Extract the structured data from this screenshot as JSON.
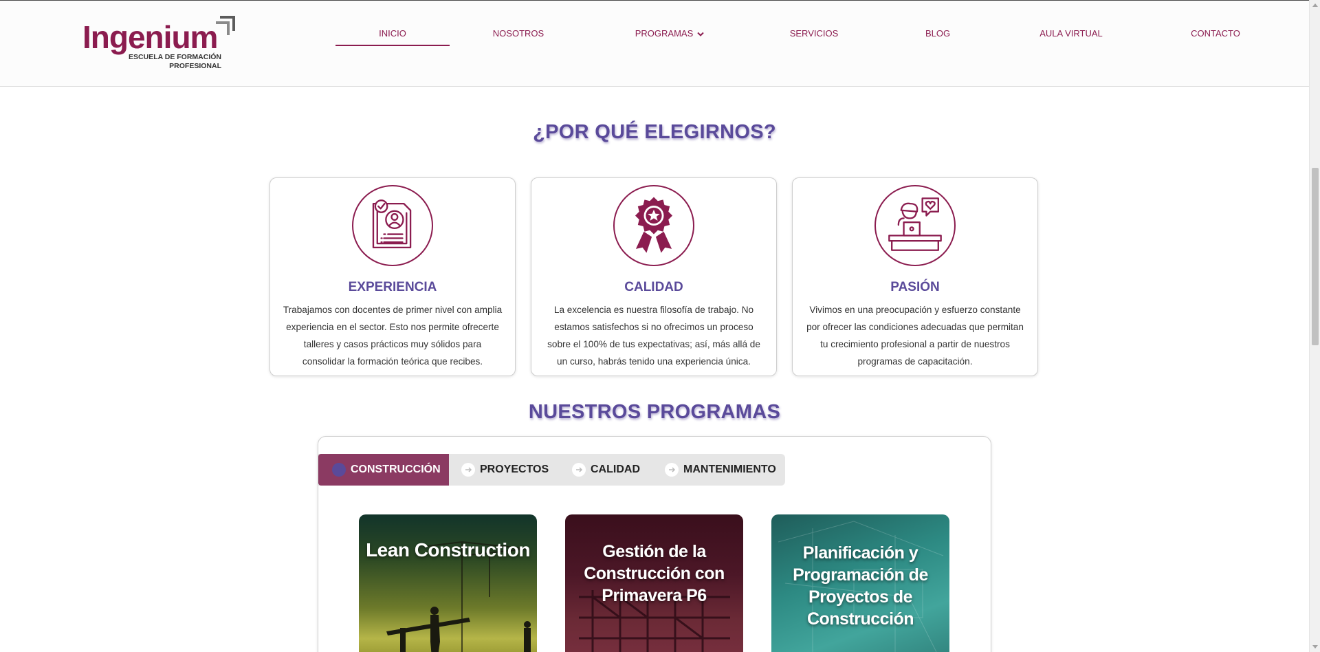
{
  "brand": {
    "name": "Ingenium",
    "tagline_line1": "ESCUELA DE FORMACIÓN",
    "tagline_line2": "PROFESIONAL",
    "color": "#8b1c4f"
  },
  "nav": {
    "items": [
      {
        "label": "INICIO",
        "active": true
      },
      {
        "label": "NOSOTROS"
      },
      {
        "label": "PROGRAMAS",
        "has_dropdown": true
      },
      {
        "label": "SERVICIOS"
      },
      {
        "label": "BLOG"
      },
      {
        "label": "AULA VIRTUAL"
      },
      {
        "label": "CONTACTO"
      }
    ]
  },
  "why": {
    "title": "¿POR QUÉ ELEGIRNOS?",
    "cards": [
      {
        "icon": "resume-checklist-icon",
        "title": "EXPERIENCIA",
        "text": "Trabajamos con docentes de primer nivel con amplia experiencia en el sector. Esto nos permite ofrecerte talleres y casos prácticos muy sólidos para consolidar la formación teórica que recibes."
      },
      {
        "icon": "award-ribbon-icon",
        "title": "CALIDAD",
        "text": "La excelencia es nuestra filosofía de trabajo. No estamos satisfechos si no ofrecimos un proceso sobre el 100% de tus expectativas; así, más allá de un curso, habrás tenido una experiencia única."
      },
      {
        "icon": "teacher-desk-heart-icon",
        "title": "PASIÓN",
        "text": "Vivimos en una preocupación y esfuerzo constante por ofrecer las condiciones adecuadas que permitan tu crecimiento profesional a partir de nuestros programas de capacitación."
      }
    ]
  },
  "programs": {
    "title": "NUESTROS PROGRAMAS",
    "tabs": [
      {
        "label": "CONSTRUCCIÓN",
        "active": true
      },
      {
        "label": "PROYECTOS"
      },
      {
        "label": "CALIDAD"
      },
      {
        "label": "MANTENIMIENTO"
      }
    ],
    "cards": [
      {
        "title": "Lean Construction"
      },
      {
        "title": "Gestión de la Construcción con Primavera P6"
      },
      {
        "title": "Planificación y Programación de Proyectos de Construcción"
      }
    ]
  },
  "colors": {
    "accent_purple": "#5a4a9a",
    "brand_maroon": "#8b1c4f",
    "tab_active": "#8b3a62"
  }
}
